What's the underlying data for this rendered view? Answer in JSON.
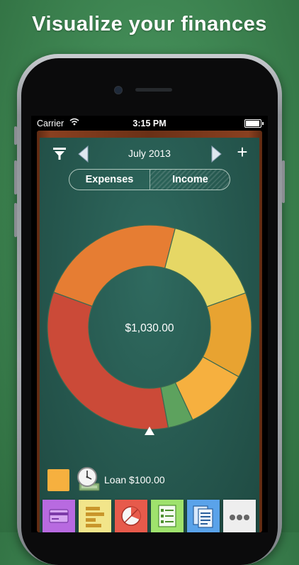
{
  "promo": {
    "headline": "Visualize your finances"
  },
  "status_bar": {
    "carrier": "Carrier",
    "time": "3:15 PM"
  },
  "header": {
    "month": "July 2013",
    "add_label": "+"
  },
  "tabs": {
    "expenses": "Expenses",
    "income": "Income",
    "selected": "Income"
  },
  "chart": {
    "center_total": "$1,030.00",
    "segments": [
      {
        "color": "#e67d33",
        "fraction": 0.235
      },
      {
        "color": "#e6d765",
        "fraction": 0.155
      },
      {
        "color": "#e8a331",
        "fraction": 0.135
      },
      {
        "color": "#f6b03f",
        "fraction": 0.1
      },
      {
        "color": "#5da25e",
        "fraction": 0.04
      },
      {
        "color": "#cb4a38",
        "fraction": 0.335
      }
    ]
  },
  "legend": {
    "label": "Loan $100.00",
    "color": "#f6b03f"
  },
  "toolbar": {
    "tiles": [
      {
        "name": "accounts",
        "icon": "card-icon",
        "color": "#b86ae0"
      },
      {
        "name": "bars",
        "icon": "bar-chart-icon",
        "color": "#f2e58a"
      },
      {
        "name": "pie",
        "icon": "pie-chart-icon",
        "color": "#e75a4b"
      },
      {
        "name": "list",
        "icon": "checklist-icon",
        "color": "#9fe26d"
      },
      {
        "name": "documents",
        "icon": "documents-icon",
        "color": "#5aa3ea"
      },
      {
        "name": "more",
        "icon": "more-icon",
        "color": "#eeeeee"
      }
    ]
  }
}
